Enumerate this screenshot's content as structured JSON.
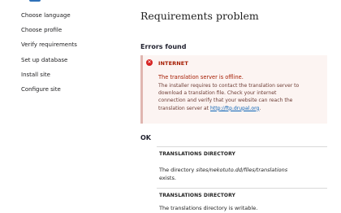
{
  "sidebar": {
    "steps": [
      {
        "label": "Choose language"
      },
      {
        "label": "Choose profile"
      },
      {
        "label": "Verify requirements"
      },
      {
        "label": "Set up database"
      },
      {
        "label": "Install site"
      },
      {
        "label": "Configure site"
      }
    ]
  },
  "main": {
    "title": "Requirements problem",
    "errors_heading": "Errors found",
    "error": {
      "title": "INTERNET",
      "summary": "The translation server is offline.",
      "detail_lines": [
        "The installer requires to contact the translation server to",
        "download a translation file. Check your internet",
        "connection and verify that your website can reach the"
      ],
      "detail_prefix": "translation server at ",
      "link_text": "http://ftp.drupal.org",
      "detail_suffix": ".",
      "icon": "error-x-icon",
      "color": "#a51b00"
    },
    "ok_heading": "OK",
    "requirements": [
      {
        "title": "TRANSLATIONS DIRECTORY",
        "text_prefix": "The directory ",
        "path": "sites/nekotuto.dd/files/translations",
        "text_suffix": "exists."
      },
      {
        "title": "TRANSLATIONS DIRECTORY",
        "text": "The translations directory is writable."
      }
    ]
  }
}
